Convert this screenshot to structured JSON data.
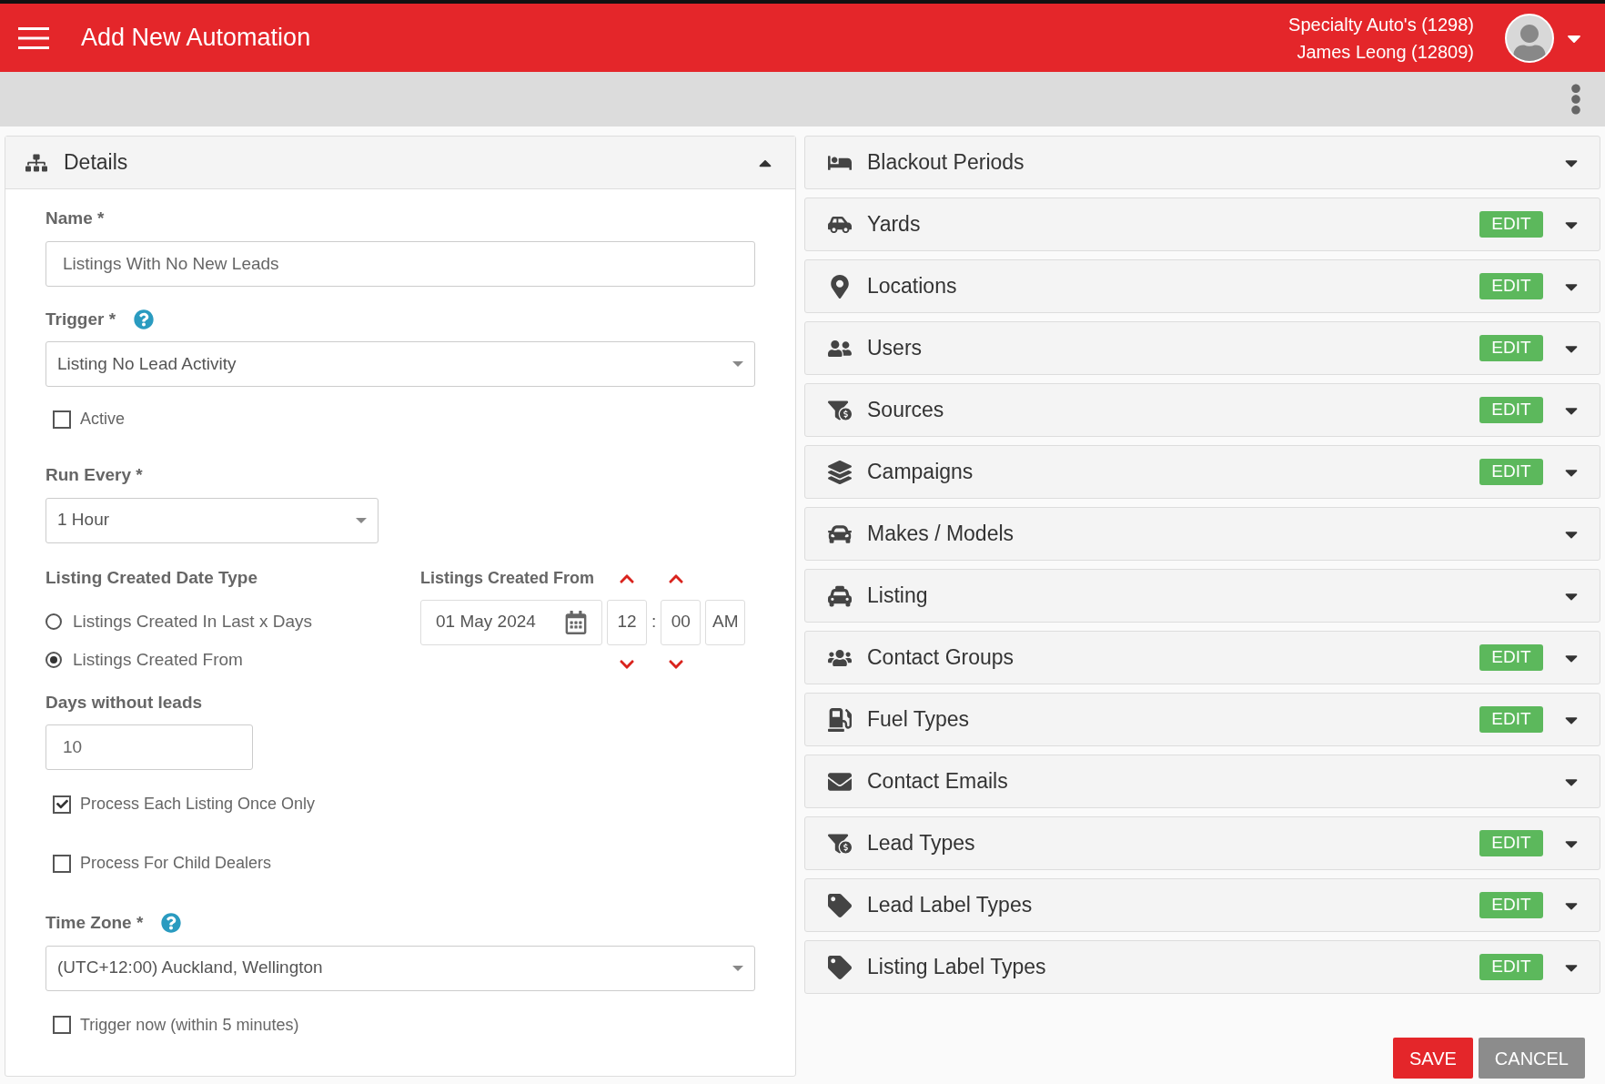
{
  "header": {
    "title": "Add New Automation",
    "account": "Specialty Auto's (1298)",
    "user": "James Leong (12809)"
  },
  "details": {
    "title": "Details",
    "expanded": true,
    "name": {
      "label": "Name *",
      "value": "Listings With No New Leads"
    },
    "trigger": {
      "label": "Trigger *",
      "value": "Listing No Lead Activity"
    },
    "active": {
      "label": "Active",
      "checked": false
    },
    "run_every": {
      "label": "Run Every *",
      "value": "1 Hour"
    },
    "date_type": {
      "label": "Listing Created Date Type",
      "options": [
        {
          "label": "Listings Created In Last x Days",
          "selected": false
        },
        {
          "label": "Listings Created From",
          "selected": true
        }
      ]
    },
    "created_from": {
      "label": "Listings Created From",
      "date": "01 May 2024",
      "hour": "12",
      "separator": ":",
      "minute": "00",
      "period": "AM"
    },
    "days": {
      "label": "Days without leads",
      "value": "10"
    },
    "options": [
      {
        "label": "Process Each Listing Once Only",
        "checked": true
      },
      {
        "label": "Process For Child Dealers",
        "checked": false
      }
    ],
    "time_zone": {
      "label": "Time Zone *",
      "value": "(UTC+12:00) Auckland, Wellington"
    },
    "trigger_now": {
      "label": "Trigger now (within 5 minutes)",
      "checked": false
    }
  },
  "sections": [
    {
      "title": "Blackout Periods",
      "expanded": false
    },
    {
      "title": "Yards",
      "edit": "EDIT",
      "expanded": false
    },
    {
      "title": "Locations",
      "edit": "EDIT",
      "expanded": false
    },
    {
      "title": "Users",
      "edit": "EDIT",
      "expanded": false
    },
    {
      "title": "Sources",
      "edit": "EDIT",
      "expanded": false
    },
    {
      "title": "Campaigns",
      "edit": "EDIT",
      "expanded": false
    },
    {
      "title": "Makes / Models",
      "expanded": false
    },
    {
      "title": "Listing",
      "expanded": false
    },
    {
      "title": "Contact Groups",
      "edit": "EDIT",
      "expanded": false
    },
    {
      "title": "Fuel Types",
      "edit": "EDIT",
      "expanded": false
    },
    {
      "title": "Contact Emails",
      "expanded": false
    },
    {
      "title": "Lead Types",
      "edit": "EDIT",
      "expanded": false
    },
    {
      "title": "Lead Label Types",
      "edit": "EDIT",
      "expanded": false
    },
    {
      "title": "Listing Label Types",
      "edit": "EDIT",
      "expanded": false
    }
  ],
  "actions": [
    {
      "label": "SAVE",
      "kind": "primary"
    },
    {
      "label": "CANCEL",
      "kind": "secondary"
    }
  ]
}
